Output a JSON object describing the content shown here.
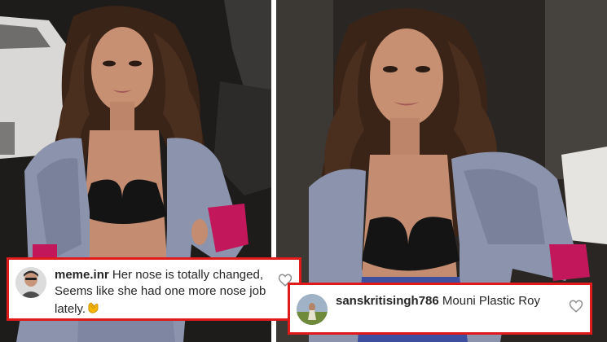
{
  "comments": [
    {
      "username": "meme.inr",
      "text": "Her nose is totally changed, Seems like she had one more nose job lately.",
      "emoji": "clapping-hands",
      "icon": "heart-outline-icon"
    },
    {
      "username": "sanskritisingh786",
      "text": "Mouni Plastic Roy",
      "icon": "heart-outline-icon"
    }
  ],
  "colors": {
    "card_border": "#e0191b",
    "username": "#262626",
    "comment_text": "#262626",
    "blazer": "#8c93ad",
    "sleeve_lining": "#c2185b",
    "hair": "#3a2418",
    "background_left": "#1e1c1b",
    "background_right": "#2a2623"
  }
}
